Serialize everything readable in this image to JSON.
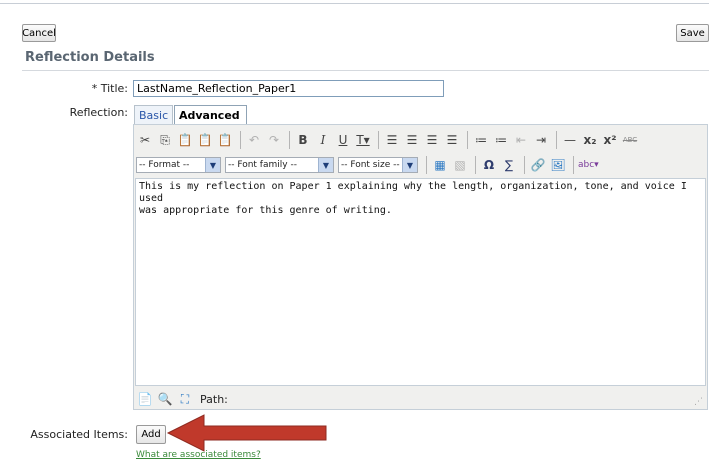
{
  "toolbar": {
    "cancel_label": "Cancel",
    "save_label": "Save"
  },
  "section": {
    "title": "Reflection Details"
  },
  "form": {
    "title_label": "* Title:",
    "title_value": "LastName_Reflection_Paper1",
    "reflection_label": "Reflection:",
    "tabs": [
      {
        "label": "Basic",
        "active": false
      },
      {
        "label": "Advanced",
        "active": true
      }
    ],
    "associated_label": "Associated Items:",
    "add_label": "Add",
    "associated_link": "What are associated items?"
  },
  "editor": {
    "format_select": "-- Format --",
    "font_family_select": "-- Font family --",
    "font_size_select": "-- Font size --",
    "content": "This is my reflection on Paper 1 explaining why the length, organization, tone, and voice I used\nwas appropriate for this genre of writing.",
    "path_label": "Path:",
    "toolbar_icons": [
      "cut-icon",
      "copy-icon",
      "paste-icon",
      "paste-text-icon",
      "paste-word-icon",
      "undo-icon",
      "redo-icon",
      "bold-icon",
      "italic-icon",
      "underline-icon",
      "text-color-icon",
      "align-left-icon",
      "align-center-icon",
      "align-right-icon",
      "justify-icon",
      "bullet-list-icon",
      "numbered-list-icon",
      "outdent-icon",
      "indent-icon",
      "horizontal-rule-icon",
      "subscript-icon",
      "superscript-icon",
      "strikethrough-icon"
    ]
  },
  "annotation": {
    "arrow_color": "#c0392b"
  }
}
